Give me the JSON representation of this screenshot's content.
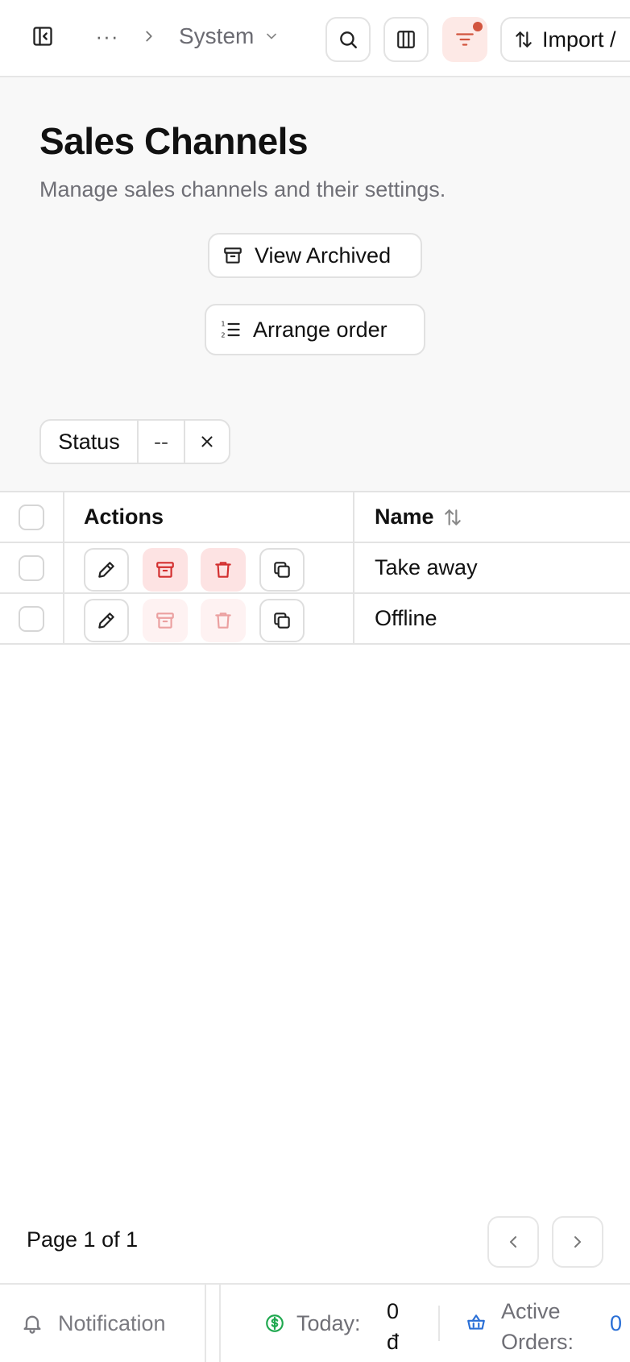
{
  "topbar": {
    "breadcrumb_more": "···",
    "breadcrumb_section": "System",
    "import_label": "Import /"
  },
  "header": {
    "title": "Sales Channels",
    "subtitle": "Manage sales channels and their settings.",
    "view_archived_label": "View Archived",
    "arrange_order_label": "Arrange order"
  },
  "filters": {
    "status_label": "Status",
    "status_value": "--"
  },
  "table": {
    "columns": {
      "actions": "Actions",
      "name": "Name"
    },
    "rows": [
      {
        "name": "Take away",
        "archive_enabled": true
      },
      {
        "name": "Offline",
        "archive_enabled": false
      }
    ]
  },
  "pagination": {
    "text": "Page 1 of 1"
  },
  "footer": {
    "notification_label": "Notification",
    "today_label": "Today:",
    "today_value_line1": "0",
    "today_value_line2": "đ",
    "active_orders_line1": "Active",
    "active_orders_line2": "Orders:",
    "active_orders_value": "0"
  },
  "colors": {
    "accent_red": "#d2553f",
    "danger": "#d32f2f",
    "link_blue": "#2a6fd6",
    "money_green": "#1fa84f"
  }
}
